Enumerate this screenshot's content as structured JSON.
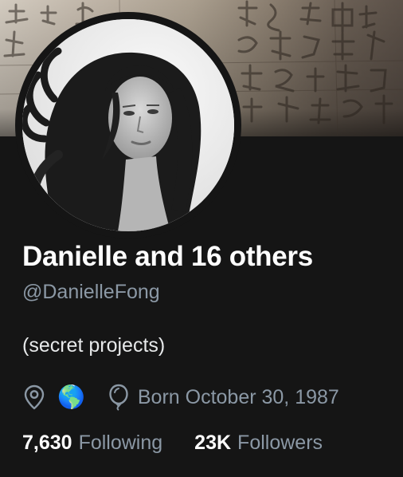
{
  "profile": {
    "display_name": "Danielle and 16 others",
    "handle": "@DanielleFong",
    "bio": "(secret projects)",
    "location_emoji": "🌎",
    "birthday": "Born October 30, 1987"
  },
  "stats": {
    "following_count": "7,630",
    "following_label": "Following",
    "followers_count": "23K",
    "followers_label": "Followers"
  },
  "icons": {
    "location": "location-pin-icon",
    "birthday": "balloon-icon"
  },
  "colors": {
    "background": "#151515",
    "primary_text": "#ffffff",
    "secondary_text": "#8b98a5"
  }
}
